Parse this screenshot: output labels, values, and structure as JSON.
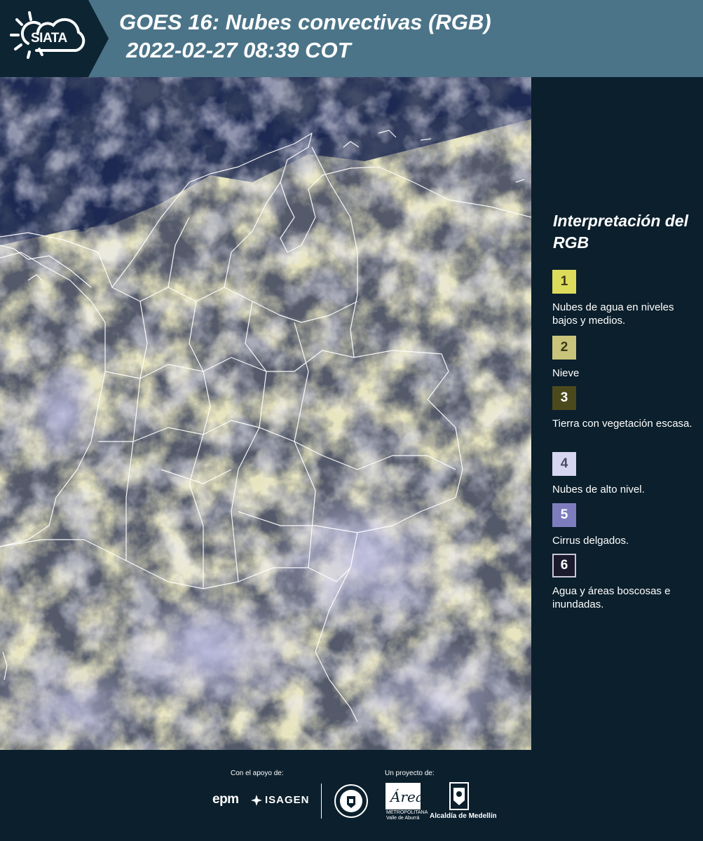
{
  "header": {
    "logo_text": "SIATA",
    "title_line1": "GOES 16: Nubes convectivas (RGB)",
    "title_line2": "2022-02-27 08:39 COT"
  },
  "map": {
    "description_icon": "satellite-rgb-image",
    "colors": {
      "ocean": "#1d2a52",
      "cloud_yellow": "#c8c26a",
      "cloud_white": "#d4d2e4",
      "cloud_lavender": "#b2b2e0",
      "border_white": "#ffffff"
    }
  },
  "legend": {
    "title": "Interpretación del RGB",
    "items": [
      {
        "number": "1",
        "color": "#dddb5b",
        "text_color": "#3a3a18",
        "outlined": false,
        "label": "Nubes de agua en niveles bajos y medios."
      },
      {
        "number": "2",
        "color": "#c9c47b",
        "text_color": "#3a3a18",
        "outlined": false,
        "label": "Nieve"
      },
      {
        "number": "3",
        "color": "#4c4a1c",
        "text_color": "#ffffff",
        "outlined": false,
        "label": "Tierra con vegetación escasa."
      },
      {
        "number": "4",
        "color": "#d6d6f0",
        "text_color": "#4a4a6a",
        "outlined": false,
        "label": "Nubes de alto nivel."
      },
      {
        "number": "5",
        "color": "#7d7dbe",
        "text_color": "#ffffff",
        "outlined": false,
        "label": "Cirrus delgados."
      },
      {
        "number": "6",
        "color": "#1a1a2c",
        "text_color": "#ffffff",
        "outlined": true,
        "label": "Agua y áreas boscosas e inundadas."
      }
    ]
  },
  "footer": {
    "support_caption": "Con el apoyo de:",
    "project_caption": "Un proyecto de:",
    "sponsor_1": "epm",
    "sponsor_2": "ISAGEN",
    "area_logo_text": "Área",
    "area_sub_1": "METROPOLITANA",
    "area_sub_2": "Valle de Aburrá",
    "alcaldia": "Alcaldía de Medellín"
  }
}
